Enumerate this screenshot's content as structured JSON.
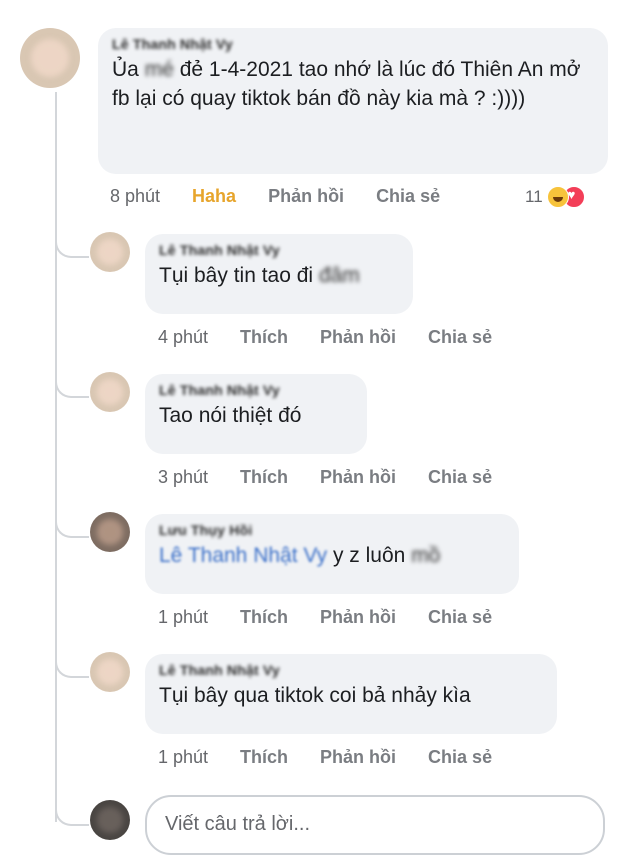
{
  "comment": {
    "author": "Lê Thanh Nhật Vy",
    "text_prefix": "Ủa",
    "text_blurred": "mé",
    "text_rest": "đẻ 1-4-2021 tao nhớ là lúc đó Thiên An mở fb lại có quay tiktok bán đồ này kia mà ? :))))",
    "time": "8 phút",
    "reaction_label": "Haha",
    "reply": "Phản hồi",
    "share": "Chia sẻ",
    "reaction_count": "11",
    "reaction_icons": [
      "haha-icon",
      "love-icon"
    ]
  },
  "replies": [
    {
      "author": "Lê Thanh Nhật Vy",
      "text": "Tụi bây tin tao đi",
      "blurred": "đâm",
      "time": "4 phút",
      "like": "Thích",
      "reply": "Phản hồi",
      "share": "Chia sẻ"
    },
    {
      "author": "Lê Thanh Nhật Vy",
      "text": "Tao nói thiệt đó",
      "time": "3 phút",
      "like": "Thích",
      "reply": "Phản hồi",
      "share": "Chia sẻ"
    },
    {
      "author": "Lưu Thụy Hồi",
      "mention": "Lê Thanh Nhật Vy",
      "text": "y z luôn",
      "blurred": "mồ",
      "time": "1 phút",
      "like": "Thích",
      "reply": "Phản hồi",
      "share": "Chia sẻ"
    },
    {
      "author": "Lê Thanh Nhật Vy",
      "text": "Tụi bây qua tiktok coi bả nhảy kìa",
      "time": "1 phút",
      "like": "Thích",
      "reply": "Phản hồi",
      "share": "Chia sẻ"
    }
  ],
  "reply_input": {
    "placeholder": "Viết câu trả lời..."
  },
  "colors": {
    "bubble": "#f0f2f5",
    "haha": "#e7a52c",
    "mention": "#3a6fc8",
    "secondary_text": "#65676b"
  }
}
